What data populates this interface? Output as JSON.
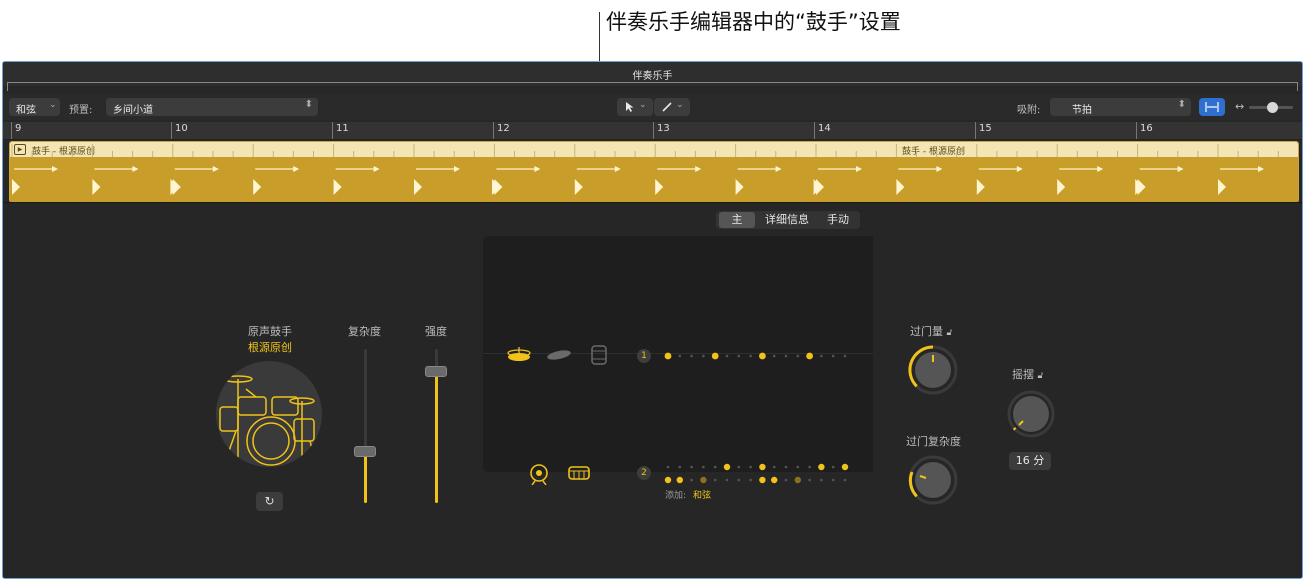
{
  "callout": {
    "text": "伴奏乐手编辑器中的“鼓手”设置"
  },
  "window": {
    "title": "伴奏乐手"
  },
  "toolbar": {
    "chord_button": "和弦",
    "preset_label": "预置:",
    "preset_value": "乡间小道",
    "snap_label": "吸附:",
    "snap_value": "节拍"
  },
  "ruler": {
    "bars": [
      "9",
      "10",
      "11",
      "12",
      "13",
      "14",
      "15",
      "16"
    ]
  },
  "region": {
    "name_1": "鼓手 - 根源原创",
    "name_2": "鼓手 - 根源原创"
  },
  "drummer": {
    "type": "原声鼓手",
    "name": "根源原创"
  },
  "sliders": {
    "complexity_label": "复杂度",
    "loudness_label": "强度",
    "complexity_value": 0.34,
    "loudness_value": 0.86
  },
  "tabs": [
    "主",
    "详细信息",
    "手动"
  ],
  "pattern": {
    "row1_number": "1",
    "row2_number": "2",
    "add_label": "添加:",
    "add_value": "和弦"
  },
  "knobs": {
    "fill_amount_label": "过门量",
    "fill_complexity_label": "过门复杂度",
    "swing_label": "摇摆",
    "swing_value": "16 分"
  },
  "colors": {
    "accent": "#f0c21a",
    "region": "#c99d2a",
    "background": "#262626"
  }
}
